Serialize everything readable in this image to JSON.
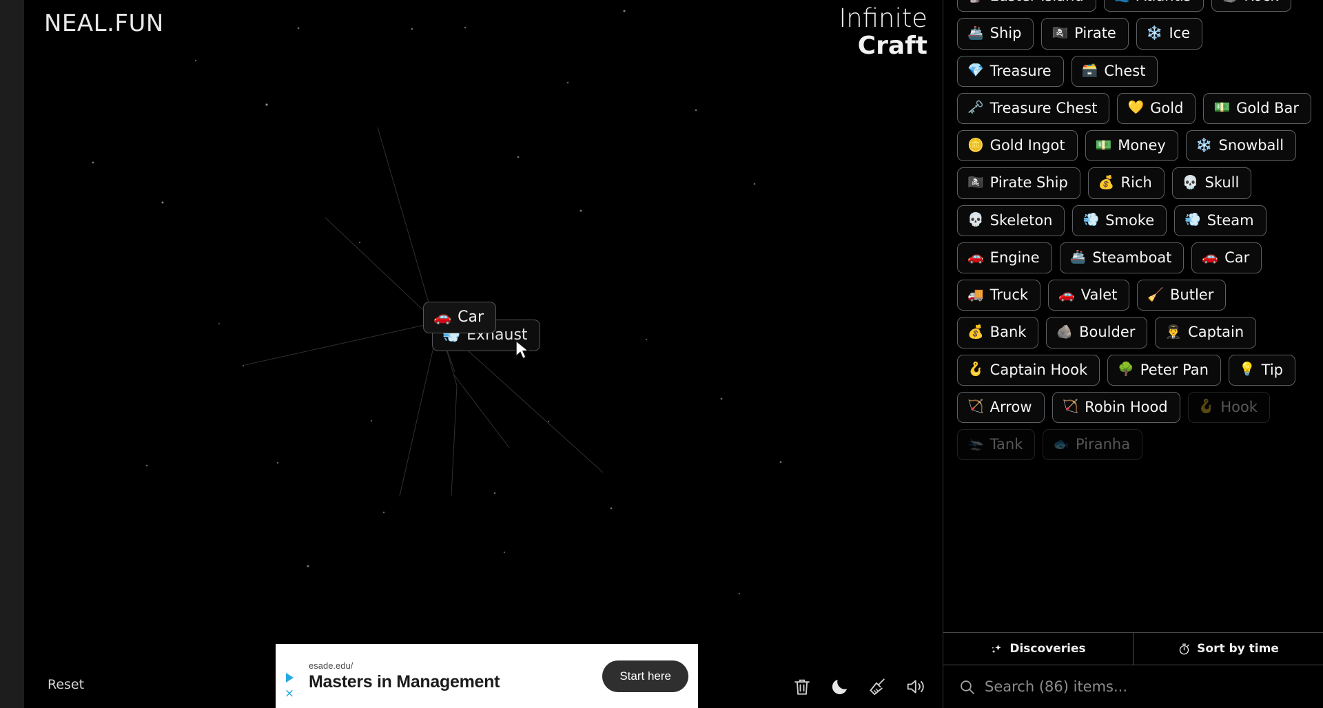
{
  "brand": "NEAL.FUN",
  "game_title": {
    "line1": "Infinite",
    "line2": "Craft"
  },
  "canvas": {
    "reset_label": "Reset",
    "cards": [
      {
        "emoji": "🚗",
        "label": "Car",
        "icon_name": "car-emoji"
      },
      {
        "emoji": "💨",
        "label": "Exhaust",
        "icon_name": "dash-emoji"
      }
    ],
    "tools": [
      {
        "name": "trash-icon",
        "title": "Delete"
      },
      {
        "name": "moon-icon",
        "title": "Dark mode"
      },
      {
        "name": "broom-icon",
        "title": "Clear"
      },
      {
        "name": "speaker-icon",
        "title": "Sound"
      }
    ]
  },
  "ad": {
    "url": "esade.edu/",
    "headline": "Masters in Management",
    "cta": "Start here",
    "close_label": "×"
  },
  "sidebar": {
    "tabs": [
      {
        "label": "Discoveries",
        "icon": "sparkles-icon"
      },
      {
        "label": "Sort by time",
        "icon": "stopwatch-icon"
      }
    ],
    "search": {
      "placeholder": "Search (86) items...",
      "value": "",
      "icon": "search-icon",
      "item_count": 86
    },
    "items": [
      {
        "emoji": "🗿",
        "label": "Easter Island",
        "icon_name": "moai-emoji"
      },
      {
        "emoji": "🌊",
        "label": "Atlantis",
        "icon_name": "wave-emoji"
      },
      {
        "emoji": "🪨",
        "label": "Rock",
        "icon_name": "rock-emoji"
      },
      {
        "emoji": "🚢",
        "label": "Ship",
        "icon_name": "ship-emoji"
      },
      {
        "emoji": "🏴‍☠️",
        "label": "Pirate",
        "icon_name": "pirate-flag-emoji"
      },
      {
        "emoji": "❄️",
        "label": "Ice",
        "icon_name": "snowflake-emoji"
      },
      {
        "emoji": "💎",
        "label": "Treasure",
        "icon_name": "gem-emoji"
      },
      {
        "emoji": "🗃️",
        "label": "Chest",
        "icon_name": "card-box-emoji"
      },
      {
        "emoji": "🗝️",
        "label": "Treasure Chest",
        "icon_name": "key-emoji"
      },
      {
        "emoji": "💛",
        "label": "Gold",
        "icon_name": "yellow-heart-emoji"
      },
      {
        "emoji": "💵",
        "label": "Gold Bar",
        "icon_name": "money-emoji"
      },
      {
        "emoji": "🪙",
        "label": "Gold Ingot",
        "icon_name": "coin-emoji"
      },
      {
        "emoji": "💵",
        "label": "Money",
        "icon_name": "money-emoji"
      },
      {
        "emoji": "❄️",
        "label": "Snowball",
        "icon_name": "snowflake-emoji"
      },
      {
        "emoji": "🏴‍☠️",
        "label": "Pirate Ship",
        "icon_name": "pirate-flag-emoji"
      },
      {
        "emoji": "💰",
        "label": "Rich",
        "icon_name": "money-bag-emoji"
      },
      {
        "emoji": "💀",
        "label": "Skull",
        "icon_name": "skull-emoji"
      },
      {
        "emoji": "💀",
        "label": "Skeleton",
        "icon_name": "skull-emoji"
      },
      {
        "emoji": "💨",
        "label": "Smoke",
        "icon_name": "dash-emoji"
      },
      {
        "emoji": "💨",
        "label": "Steam",
        "icon_name": "dash-emoji"
      },
      {
        "emoji": "🚗",
        "label": "Engine",
        "icon_name": "car-emoji"
      },
      {
        "emoji": "🚢",
        "label": "Steamboat",
        "icon_name": "ship-emoji"
      },
      {
        "emoji": "🚗",
        "label": "Car",
        "icon_name": "car-emoji"
      },
      {
        "emoji": "🚚",
        "label": "Truck",
        "icon_name": "truck-emoji"
      },
      {
        "emoji": "🚗",
        "label": "Valet",
        "icon_name": "car-emoji"
      },
      {
        "emoji": "🧹",
        "label": "Butler",
        "icon_name": "broom-emoji"
      },
      {
        "emoji": "💰",
        "label": "Bank",
        "icon_name": "money-bag-emoji"
      },
      {
        "emoji": "🪨",
        "label": "Boulder",
        "icon_name": "rock-emoji"
      },
      {
        "emoji": "👨‍✈️",
        "label": "Captain",
        "icon_name": "pilot-emoji"
      },
      {
        "emoji": "🪝",
        "label": "Captain Hook",
        "icon_name": "hook-emoji"
      },
      {
        "emoji": "🌳",
        "label": "Peter Pan",
        "icon_name": "tree-emoji"
      },
      {
        "emoji": "💡",
        "label": "Tip",
        "icon_name": "bulb-emoji"
      },
      {
        "emoji": "🏹",
        "label": "Arrow",
        "icon_name": "bow-emoji"
      },
      {
        "emoji": "🏹",
        "label": "Robin Hood",
        "icon_name": "bow-emoji"
      },
      {
        "emoji": "🪝",
        "label": "Hook",
        "icon_name": "hook-emoji"
      },
      {
        "emoji": "🛬",
        "label": "Tank",
        "icon_name": "tank-emoji"
      },
      {
        "emoji": "🐟",
        "label": "Piranha",
        "icon_name": "fish-emoji"
      }
    ]
  },
  "colors": {
    "bg": "#000000",
    "page_bg": "#1d1d1d",
    "item_border": "#5c6063",
    "text": "#f7f7f7",
    "muted": "#8d8d8d",
    "ad_accent": "#26a9e0"
  }
}
